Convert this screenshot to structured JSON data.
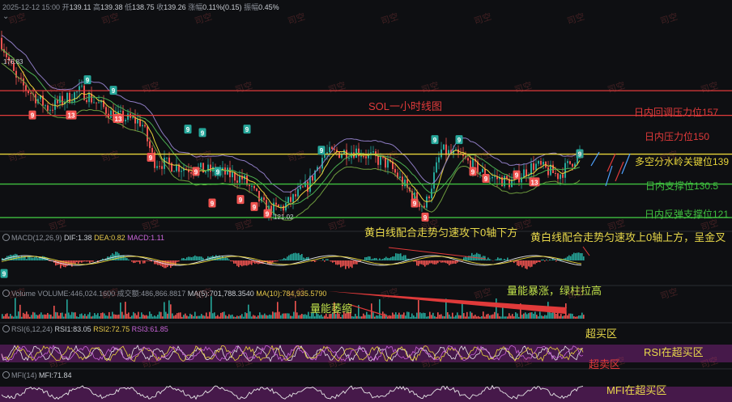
{
  "header": {
    "date": "2025-12-12 15:00",
    "open_label": "开",
    "open": "139.11",
    "high_label": "高",
    "high": "139.38",
    "low_label": "低",
    "low": "138.75",
    "close_label": "收",
    "close": "139.26",
    "chg_label": "涨幅",
    "chg": "0.11%(0.15)",
    "amp_label": "振幅",
    "amp": "0.45%"
  },
  "watermark": "司空",
  "price_panel": {
    "title": "SOL一小时线图",
    "high_mark": "176.83",
    "low_mark": "121.02",
    "levels": [
      {
        "label": "日内回调压力位157",
        "value": 157,
        "color": "#e03a3a"
      },
      {
        "label": "日内压力位150",
        "value": 150,
        "color": "#e03a3a"
      },
      {
        "label": "多空分水岭关键位139",
        "value": 139,
        "color": "#e7d43a"
      },
      {
        "label": "日内支撑位130.5",
        "value": 130.5,
        "color": "#3fbf3f"
      },
      {
        "label": "日内反弹支撑位121",
        "value": 121,
        "color": "#3fbf3f"
      }
    ]
  },
  "macd": {
    "name": "MACD(12,26,9)",
    "dif_label": "DIF:",
    "dif": "1.38",
    "dea_label": "DEA:",
    "dea": "0.82",
    "macd_label": "MACD:",
    "macd": "1.11",
    "note_left": "黄白线配合走势匀速攻下0轴下方",
    "note_right": "黄白线配合走势匀速攻上0轴上方，呈金叉"
  },
  "volume": {
    "vol_label": "Volume",
    "vol": "VOLUME:446,024.1600",
    "turnover": "成交额:486,866.8817",
    "ma5_label": "MA(5):",
    "ma5": "701,788.3540",
    "ma10_label": "MA(10):",
    "ma10": "784,935.5790",
    "note_shrink": "量能萎缩",
    "note_surge": "量能暴涨，绿柱拉高"
  },
  "rsi": {
    "name": "RSI(6,12,24)",
    "rsi1_label": "RSI1:",
    "rsi1": "83.05",
    "rsi2_label": "RSI2:",
    "rsi2": "72.75",
    "rsi3_label": "RSI3:",
    "rsi3": "61.85",
    "overbought": "超买区",
    "oversold": "超卖区",
    "note": "RSI在超买区"
  },
  "mfi": {
    "name": "MFI(14)",
    "mfi_label": "MFI:",
    "mfi": "71.84",
    "note": "MFI在超买区"
  },
  "chart_data": {
    "type": "candlestick",
    "title": "SOL一小时线图",
    "ylim": [
      118,
      180
    ],
    "annotated_high": 176.83,
    "annotated_low": 121.02,
    "horizontal_levels": [
      157,
      150,
      139,
      130.5,
      121
    ],
    "last_close": 139.26,
    "indicators": [
      "MACD(12,26,9)",
      "VOLUME",
      "RSI(6,12,24)",
      "MFI(14)"
    ],
    "colors": {
      "up": "#26a69a",
      "down": "#ef5350",
      "ma_yellow": "#e7d43a",
      "ma_green": "#4caf50",
      "ma_purple": "#8e7cc3"
    }
  }
}
